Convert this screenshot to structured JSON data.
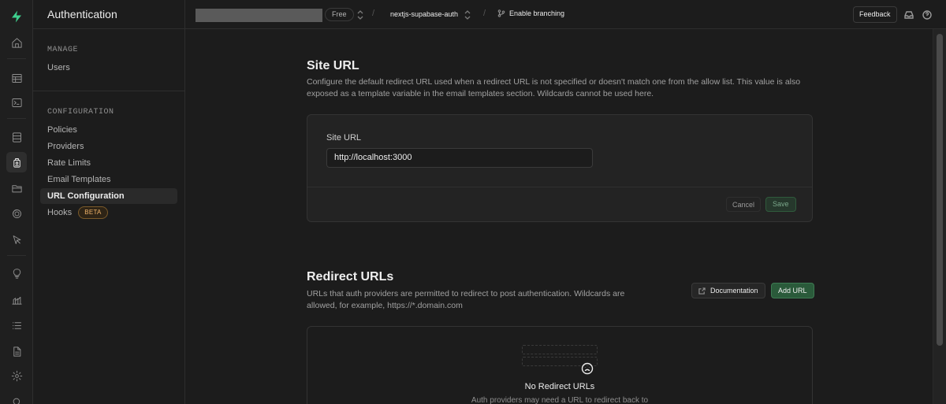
{
  "menu": {
    "title": "Authentication",
    "sections": [
      {
        "title": "MANAGE",
        "items": [
          {
            "label": "Users"
          }
        ]
      },
      {
        "title": "CONFIGURATION",
        "items": [
          {
            "label": "Policies"
          },
          {
            "label": "Providers"
          },
          {
            "label": "Rate Limits"
          },
          {
            "label": "Email Templates"
          },
          {
            "label": "URL Configuration",
            "active": true
          },
          {
            "label": "Hooks",
            "badge": "BETA"
          }
        ]
      }
    ]
  },
  "rail": {
    "icons": [
      "supabase-logo-icon",
      "home-icon",
      "table-editor-icon",
      "sql-editor-icon",
      "database-icon",
      "authentication-icon",
      "storage-icon",
      "realtime-icon",
      "edge-functions-icon",
      "advisors-icon",
      "reports-icon",
      "logs-icon",
      "api-docs-icon",
      "settings-icon",
      "search-icon"
    ],
    "active": "authentication-icon"
  },
  "topbar": {
    "plan": "Free",
    "project": "nextjs-supabase-auth",
    "branching": "Enable branching",
    "feedback": "Feedback"
  },
  "site_url": {
    "title": "Site URL",
    "description": "Configure the default redirect URL used when a redirect URL is not specified or doesn't match one from the allow list. This value is also exposed as a template variable in the email templates section. Wildcards cannot be used here.",
    "field_label": "Site URL",
    "field_value": "http://localhost:3000",
    "cancel": "Cancel",
    "save": "Save"
  },
  "redirect_urls": {
    "title": "Redirect URLs",
    "description": "URLs that auth providers are permitted to redirect to post authentication. Wildcards are allowed, for example, https://*.domain.com",
    "documentation": "Documentation",
    "add_url": "Add URL",
    "empty_title": "No Redirect URLs",
    "empty_desc": "Auth providers may need a URL to redirect back to"
  },
  "colors": {
    "brand": "#3ecf8e",
    "background": "#1c1c1c",
    "beta": "#f1b46a"
  }
}
